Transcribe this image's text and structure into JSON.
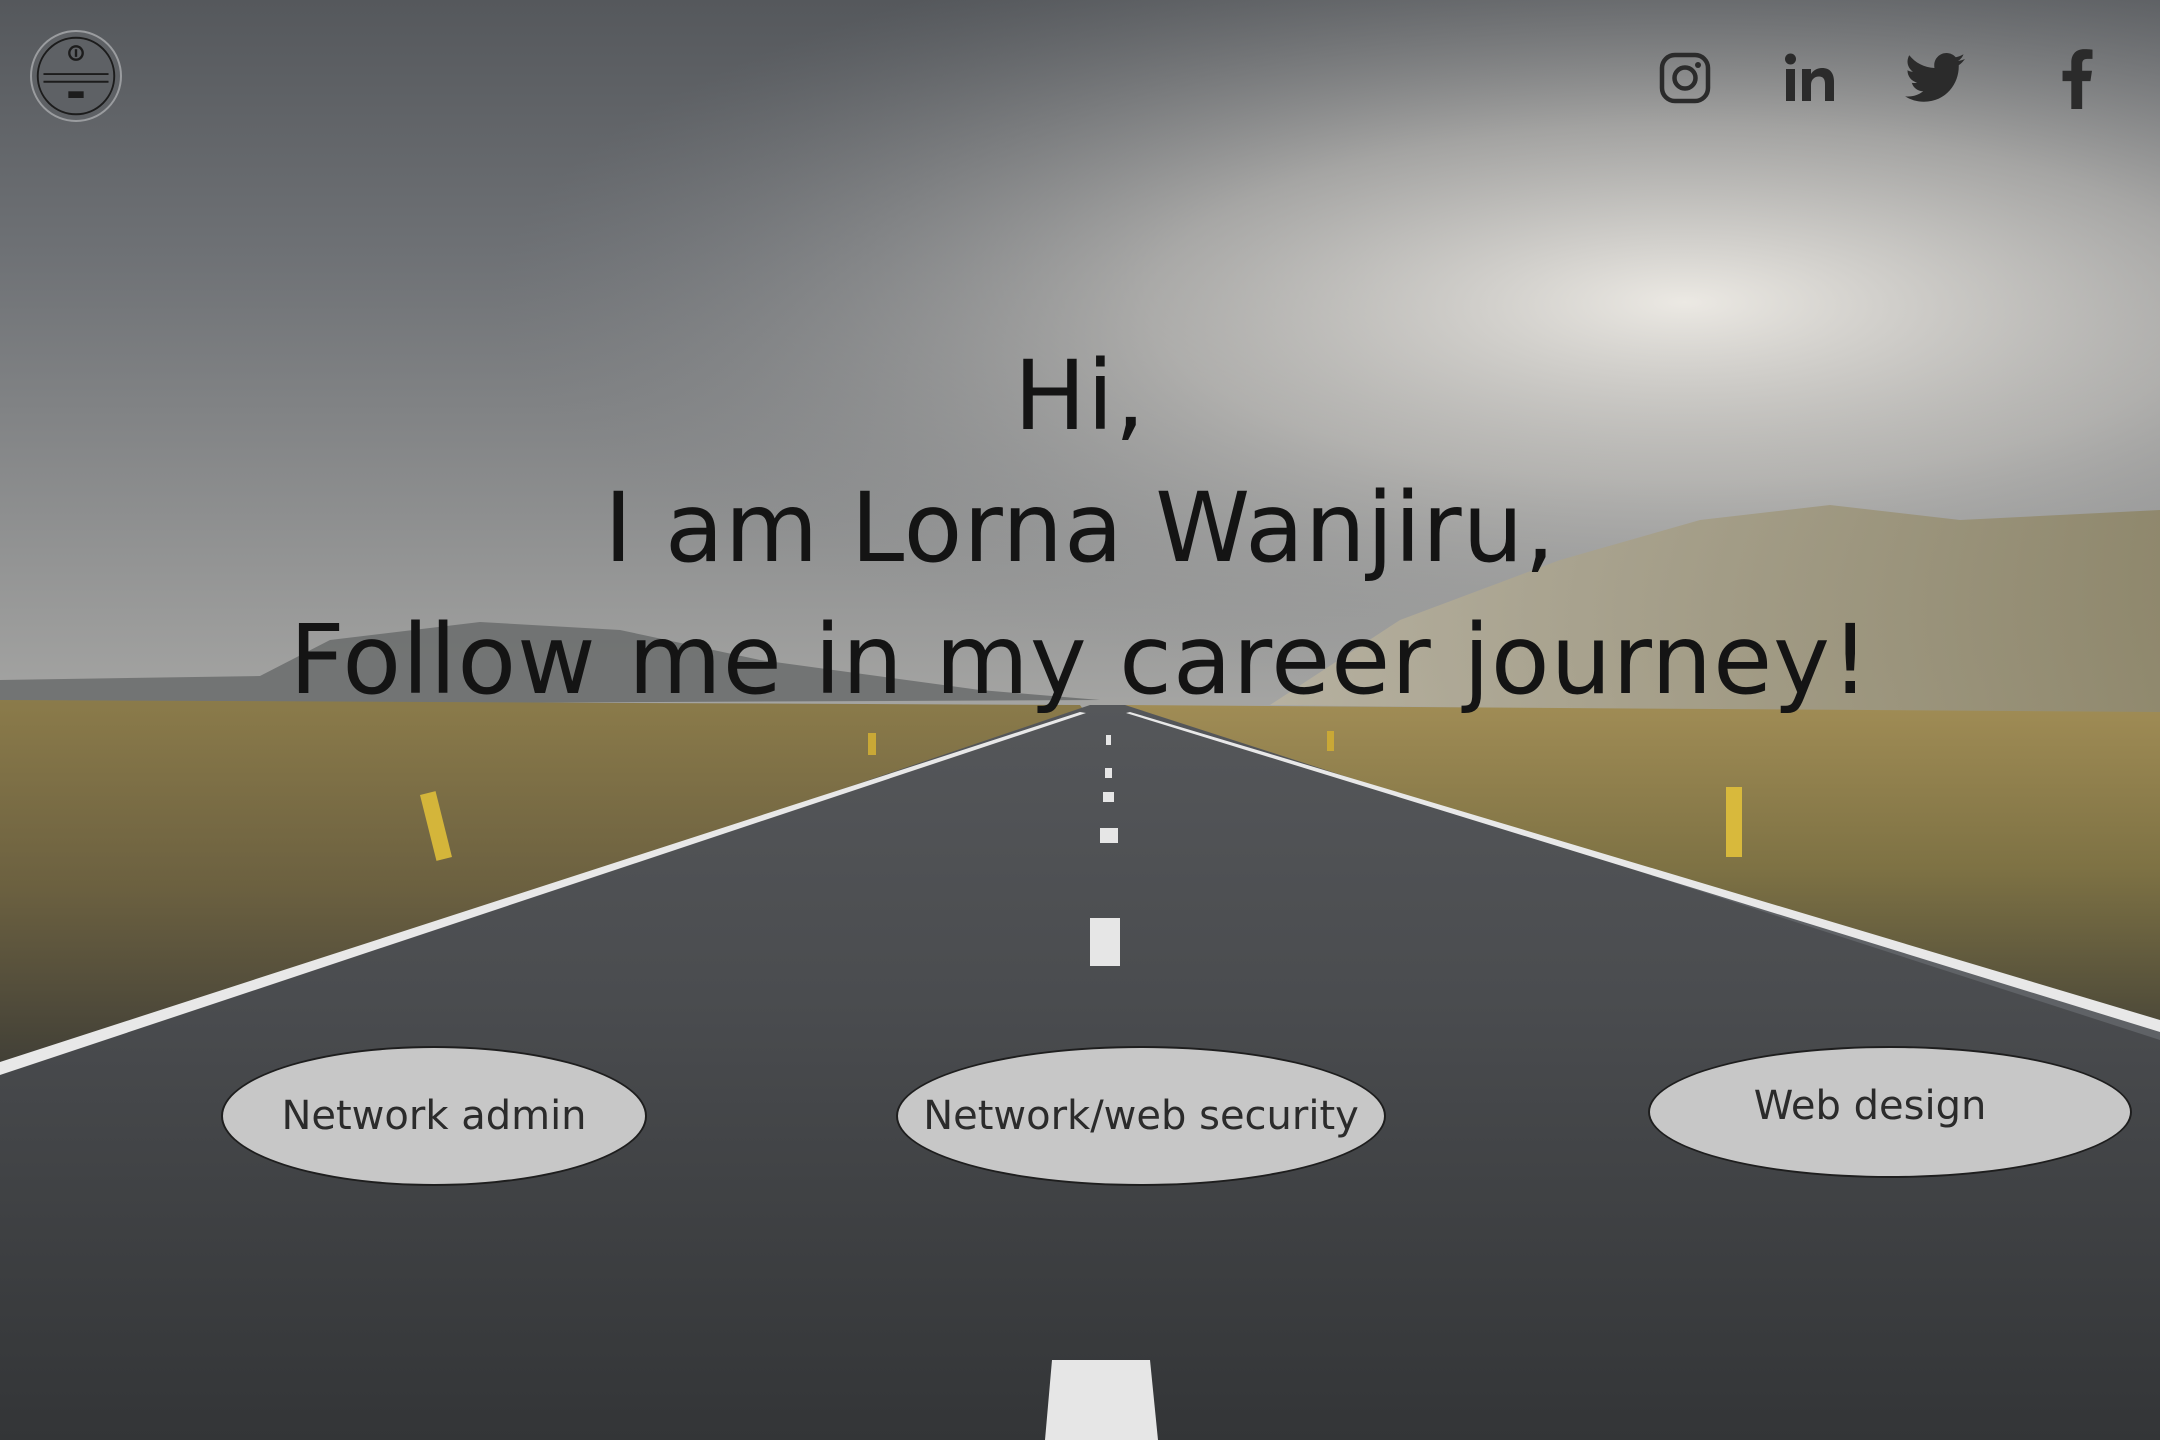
{
  "header": {
    "logo_icon": "circular-badge-logo",
    "social_links": [
      {
        "name": "instagram",
        "icon": "instagram-icon"
      },
      {
        "name": "linkedin",
        "icon": "linkedin-icon"
      },
      {
        "name": "twitter",
        "icon": "twitter-icon"
      },
      {
        "name": "facebook",
        "icon": "facebook-icon"
      }
    ],
    "icon_color": "#2b2b2b"
  },
  "hero": {
    "line1": "Hi,",
    "line2": "I am Lorna Wanjiru,",
    "line3": "Follow me in my career journey!",
    "text_color": "#141414"
  },
  "careers": [
    {
      "label": "Network admin"
    },
    {
      "label": "Network/web security"
    },
    {
      "label": "Web design"
    }
  ],
  "colors": {
    "button_fill": "#c7c7c7",
    "button_border": "#1e1e1e"
  }
}
